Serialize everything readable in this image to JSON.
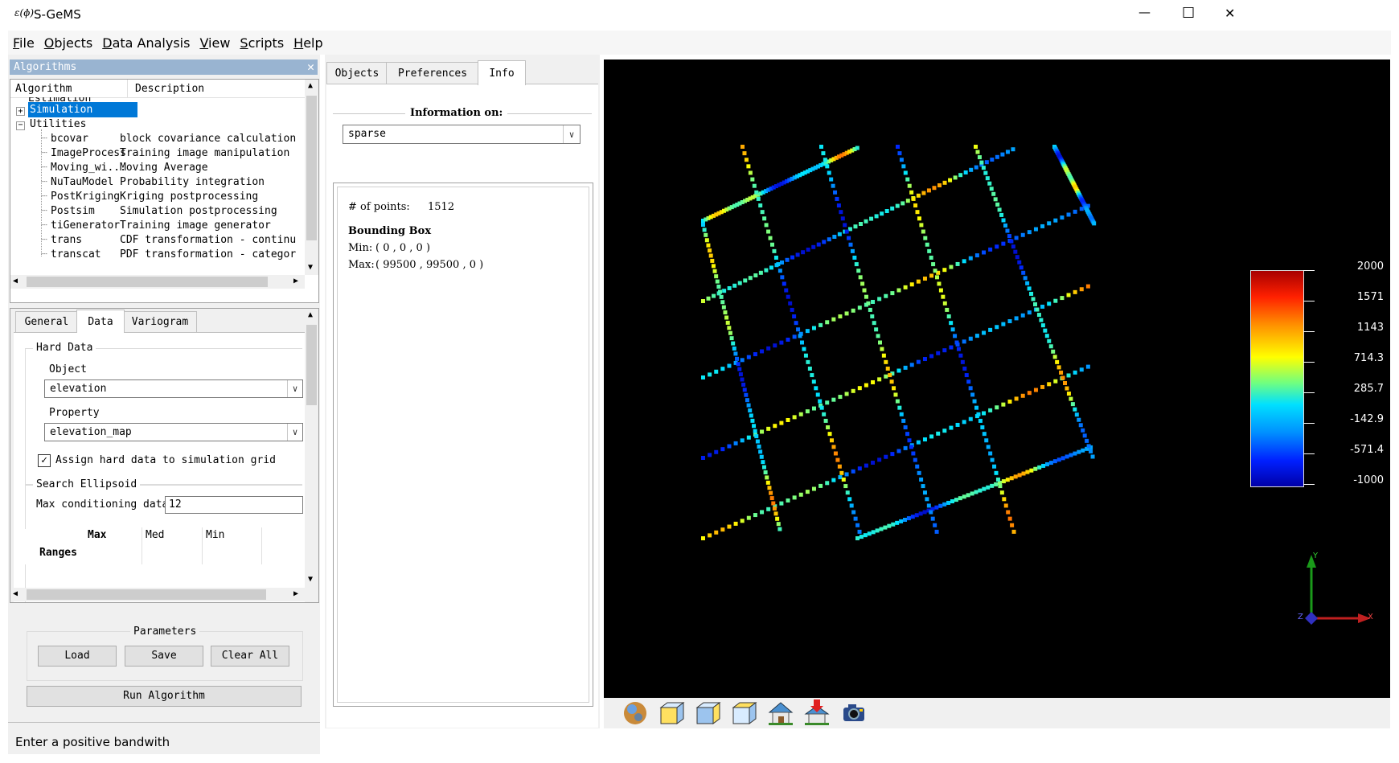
{
  "window": {
    "app_icon_text": "ɛ(ɸ)",
    "title": "S-GeMS",
    "minimize": "—",
    "maximize": "☐",
    "close": "✕"
  },
  "menu": [
    "File",
    "Objects",
    "Data Analysis",
    "View",
    "Scripts",
    "Help"
  ],
  "algorithms_panel": {
    "title": "Algorithms",
    "close": "✕",
    "columns": [
      "Algorithm",
      "Description"
    ],
    "rows": [
      {
        "name": "Estimation",
        "desc": "",
        "kind": "cut"
      },
      {
        "name": "Simulation",
        "desc": "",
        "kind": "selected"
      },
      {
        "name": "Utilities",
        "desc": "",
        "kind": "expanded"
      },
      {
        "name": "bcovar",
        "desc": "block covariance calculation"
      },
      {
        "name": "ImageProcess",
        "desc": "Training image manipulation"
      },
      {
        "name": "Moving_wi...",
        "desc": "Moving Average"
      },
      {
        "name": "NuTauModel",
        "desc": "Probability integration"
      },
      {
        "name": "PostKriging",
        "desc": "Kriging postprocessing"
      },
      {
        "name": "Postsim",
        "desc": "Simulation postprocessing"
      },
      {
        "name": "tiGenerator",
        "desc": "Training image generator"
      },
      {
        "name": "trans",
        "desc": "CDF transformation - continu"
      },
      {
        "name": "transcat",
        "desc": "PDF transformation - categor"
      }
    ]
  },
  "param_tabs": [
    "General",
    "Data",
    "Variogram"
  ],
  "hard_data": {
    "legend": "Hard Data",
    "object_label": "Object",
    "object_value": "elevation",
    "property_label": "Property",
    "property_value": "elevation_map",
    "assign_label": "Assign hard data to simulation grid",
    "assign_checked": true
  },
  "search_ellipsoid": {
    "legend": "Search Ellipsoid",
    "max_cond_label": "Max conditioning data",
    "max_cond_value": "12",
    "headers": [
      "Max",
      "Med",
      "Min"
    ],
    "row_label": "Ranges"
  },
  "parameters": {
    "legend": "Parameters",
    "load": "Load",
    "save": "Save",
    "clear_all": "Clear All",
    "run": "Run Algorithm"
  },
  "status_bar": "Enter a positive bandwith",
  "right_tabs": [
    "Objects",
    "Preferences",
    "Info"
  ],
  "info": {
    "header": "Information on:",
    "object": "sparse",
    "points_label": "# of points:",
    "points_value": "1512",
    "bbox_label": "Bounding Box",
    "min_label": "Min:",
    "min_value": "( 0 , 0 , 0 )",
    "max_label": "Max:",
    "max_value": "( 99500 , 99500 , 0 )"
  },
  "colorbar": {
    "labels": [
      "2000",
      "1571",
      "1143",
      "714.3",
      "285.7",
      "-142.9",
      "-571.4",
      "-1000"
    ]
  },
  "axes": {
    "y": "Y",
    "x": "X",
    "z": "Z"
  },
  "view_toolbar": [
    "globe-icon",
    "cube-front-icon",
    "cube-side-icon",
    "cube-top-icon",
    "home-icon",
    "set-home-icon",
    "snapshot-camera-icon"
  ]
}
